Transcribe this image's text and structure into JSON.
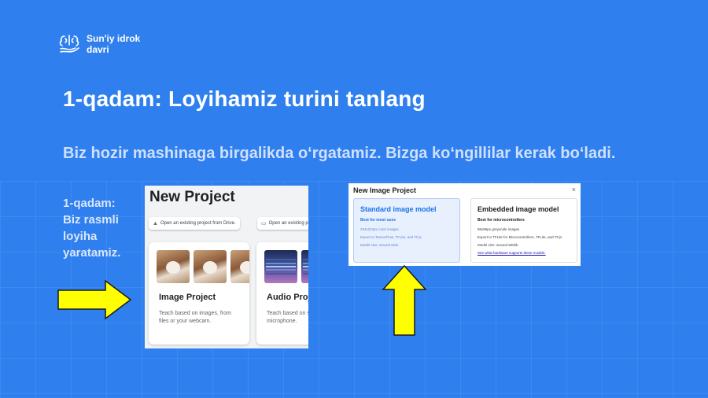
{
  "brand": {
    "line1": "Sun'iy idrok",
    "line2": "davri"
  },
  "title": "1-qadam: Loyihamiz turini tanlang",
  "subtitle": "Biz hozir mashinaga birgalikda o‘rgatamiz. Bizga ko‘ngillilar kerak bo‘ladi.",
  "step": {
    "line1": "1-qadam:",
    "line2": "Biz rasmli",
    "line3": "loyiha",
    "line4": "yaratamiz."
  },
  "new_project": {
    "title": "New Project",
    "open_drive": "Open an existing project from Drive.",
    "open_file": "Open an existing p",
    "image_card": {
      "title": "Image Project",
      "desc": "Teach based on images, from files or your webcam."
    },
    "audio_card": {
      "title": "Audio Proj",
      "desc": "Teach based on sounds, from file microphone."
    }
  },
  "dialog": {
    "title": "New Image Project",
    "close": "×",
    "standard": {
      "title": "Standard image model",
      "subtitle": "Best for most uses",
      "line1": "224x224px color images",
      "line2": "Export to TensorFlow, TFLite, and TF.js",
      "line3": "Model size: around 5mb"
    },
    "embedded": {
      "title": "Embedded image model",
      "subtitle": "Best for microcontrollers",
      "line1": "96x96px greyscale images",
      "line2": "Export to TFLite for Microcontrollers, TFLite, and TF.js",
      "line3": "Model size: around 500kb",
      "link": "See what hardware supports these models."
    }
  },
  "colors": {
    "background": "#2f80ee",
    "arrow": "#ffff00",
    "arrow_outline": "#1a1a1a"
  },
  "icons": {
    "logo": "brain-hand-logo",
    "drive": "google-drive-icon",
    "folder": "folder-icon",
    "close": "close-icon"
  }
}
